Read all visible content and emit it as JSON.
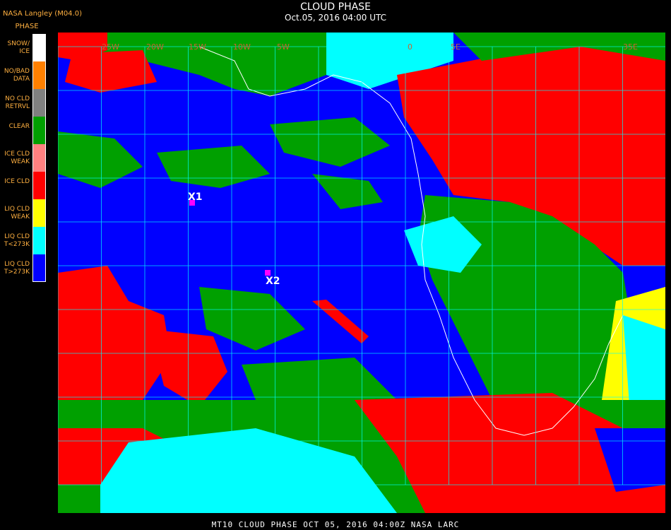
{
  "header": {
    "source": "NASA Langley (M04.0)",
    "legend_heading": "PHASE",
    "title": "CLOUD PHASE",
    "subtitle": "Oct.05, 2016 04:00 UTC"
  },
  "legend": [
    {
      "label": "SNOW/\nICE",
      "color": "#ffffff"
    },
    {
      "label": "NO/BAD\nDATA",
      "color": "#ff8000"
    },
    {
      "label": "NO CLD\nRETRVL",
      "color": "#808080"
    },
    {
      "label": "CLEAR",
      "color": "#00a000"
    },
    {
      "label": "ICE CLD\nWEAK",
      "color": "#ff8080"
    },
    {
      "label": "ICE CLD",
      "color": "#ff0000"
    },
    {
      "label": "LIQ CLD\nWEAK",
      "color": "#ffff00"
    },
    {
      "label": "LIQ CLD\nT<273K",
      "color": "#00ffff"
    },
    {
      "label": "LIQ CLD\nT>273K",
      "color": "#0000ff"
    }
  ],
  "longitude_labels": [
    "25W",
    "20W",
    "15W",
    "10W",
    "5W",
    "0",
    "5E",
    "35E"
  ],
  "markers": [
    {
      "label": "X1",
      "color": "#ff00ff"
    },
    {
      "label": "X2",
      "color": "#ff00ff"
    }
  ],
  "footer": "MT10   CLOUD PHASE   OCT 05, 2016 04:00Z   NASA LARC"
}
